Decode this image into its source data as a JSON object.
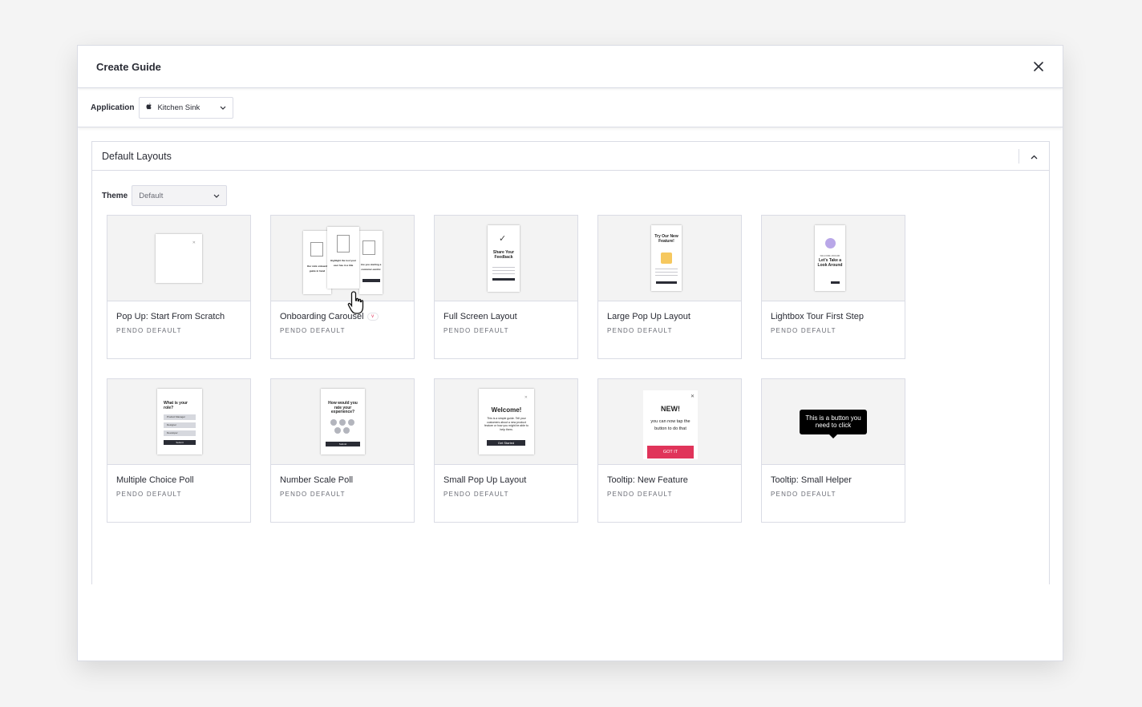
{
  "modal": {
    "title": "Create Guide",
    "close_icon": "close-icon"
  },
  "application": {
    "label": "Application",
    "selected": "Kitchen Sink",
    "icon": "apple-icon"
  },
  "panel": {
    "title": "Default Layouts",
    "theme_label": "Theme",
    "theme_selected": "Default"
  },
  "cards": [
    {
      "title": "Pop Up: Start From Scratch",
      "subtitle": "PENDO DEFAULT"
    },
    {
      "title": "Onboarding Carousel",
      "subtitle": "PENDO DEFAULT",
      "badge": "v"
    },
    {
      "title": "Full Screen Layout",
      "subtitle": "PENDO DEFAULT"
    },
    {
      "title": "Large Pop Up Layout",
      "subtitle": "PENDO DEFAULT"
    },
    {
      "title": "Lightbox Tour First Step",
      "subtitle": "PENDO DEFAULT"
    },
    {
      "title": "Multiple Choice Poll",
      "subtitle": "PENDO DEFAULT"
    },
    {
      "title": "Number Scale Poll",
      "subtitle": "PENDO DEFAULT"
    },
    {
      "title": "Small Pop Up Layout",
      "subtitle": "PENDO DEFAULT"
    },
    {
      "title": "Tooltip: New Feature",
      "subtitle": "PENDO DEFAULT"
    },
    {
      "title": "Tooltip: Small Helper",
      "subtitle": "PENDO DEFAULT"
    }
  ],
  "thumbs": {
    "carousel_a": "Our mini onboard guide in hand",
    "carousel_b": "Highlight the tool your user has in a title",
    "carousel_c": "Are you starting a customer-centric",
    "full_screen": "Share Your Feedback",
    "large_popup": "Try Our New Feature!",
    "lightbox_kicker": "WELCOME ABOARD",
    "lightbox": "Let's Take a Look Around",
    "mc_poll": "What is your role?",
    "mc_options": [
      "Product Manager",
      "Designer",
      "Developer"
    ],
    "mc_submit": "Submit",
    "number_poll": "How would you rate your experience?",
    "number_submit": "Submit",
    "small_popup_title": "Welcome!",
    "small_popup_body": "This is a simple guide. Tell your customers about a new product feature or how you might be able to help them.",
    "small_popup_btn": "Get Started",
    "tooltip_new_title": "NEW!",
    "tooltip_new_body": "you can now tap the button to do that",
    "tooltip_new_btn": "GOT IT",
    "tooltip_helper": "This is a button you need to click"
  },
  "colors": {
    "accent": "#e0345a",
    "text": "#2a2c35",
    "border": "#dadce5"
  }
}
